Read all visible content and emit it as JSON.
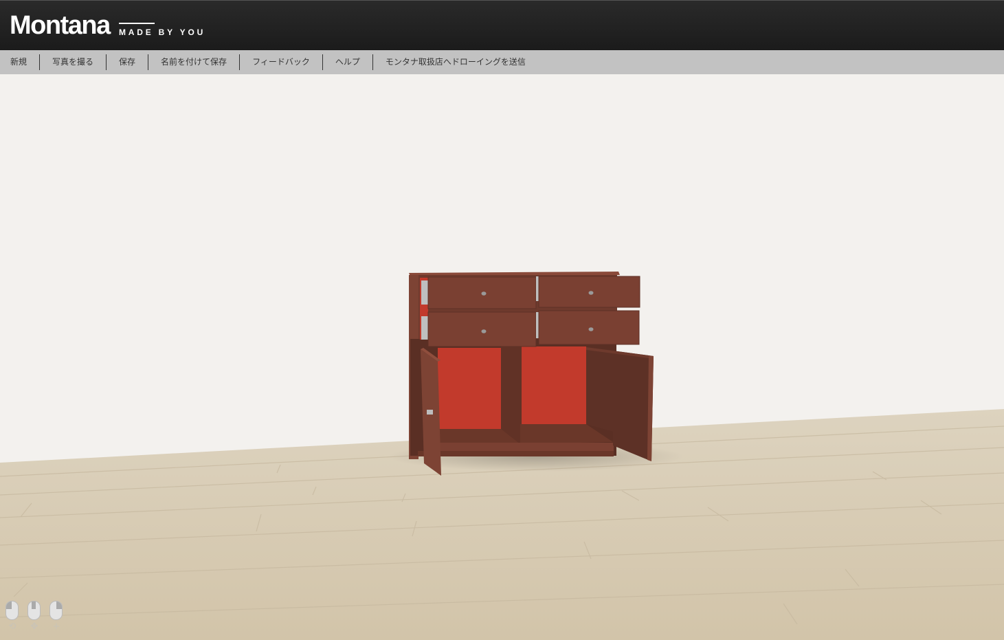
{
  "header": {
    "logo_text": "Montana",
    "tagline": "MADE BY YOU"
  },
  "menu": {
    "items": [
      {
        "label": "新規"
      },
      {
        "label": "写真を撮る"
      },
      {
        "label": "保存"
      },
      {
        "label": "名前を付けて保存"
      },
      {
        "label": "フィードバック"
      },
      {
        "label": "ヘルプ"
      },
      {
        "label": "モンタナ取扱店へドローイングを送信"
      }
    ]
  },
  "viewport": {
    "content": "3D cabinet with 4 open drawers and 2 open doors",
    "colors": {
      "wall": "#f3f1ee",
      "floor": "#d6cab4",
      "cabinet_body": "#7a4032",
      "cabinet_dark": "#5d3126",
      "cabinet_interior": "#c23a2c",
      "handle": "#9a9a9a"
    }
  },
  "mouse_controls": [
    {
      "icon": "mouse-left-rotate-icon",
      "glyph": "⟲"
    },
    {
      "icon": "mouse-middle-pan-icon",
      "glyph": "✥"
    },
    {
      "icon": "mouse-right-zoom-icon",
      "glyph": "+"
    }
  ]
}
